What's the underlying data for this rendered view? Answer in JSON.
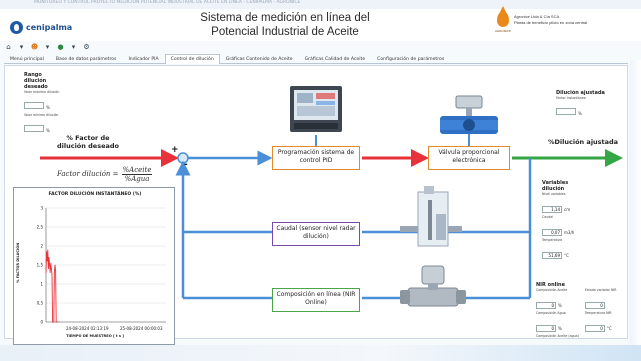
{
  "window": {
    "title": "MONITOREO Y CONTROL PROYECTO MEDICIÓN POTENCIAL INDUSTRIAL DE ACEITE EN LINEA - CENIPALMA - AGRONICE"
  },
  "header": {
    "brand": "cenipalma",
    "title_line1": "Sistema de medición en línea del",
    "title_line2": "Potencial Industrial de Aceite",
    "logo_caption": "AGRONICE",
    "company_line1": "Agronice Ltda & Cía SCA",
    "company_line2": "Planta de beneficio piloto en zona central"
  },
  "toolbar": {
    "icons": [
      "home-icon",
      "arrow-icon",
      "user-icon",
      "green-icon",
      "settings-icon"
    ]
  },
  "tabs": [
    {
      "label": "Menú principal",
      "active": false
    },
    {
      "label": "Base de datos parámetros",
      "active": false
    },
    {
      "label": "Indicador PIA",
      "active": false
    },
    {
      "label": "Control de dilución",
      "active": true
    },
    {
      "label": "Gráficas Contenido de Aceite",
      "active": false
    },
    {
      "label": "Gráficas Calidad de Aceite",
      "active": false
    },
    {
      "label": "Configuración de parámetros",
      "active": false
    }
  ],
  "rango": {
    "title": "Rango dilución deseado",
    "max_label": "Valor máximo dilución",
    "max_value": "",
    "min_label": "Valor mínimo dilución",
    "min_value": "",
    "unit": "%"
  },
  "setpoint": {
    "title": "% Factor de dilución deseado",
    "formula_lhs": "Factor dilución =",
    "formula_num": "%Aceite",
    "formula_den": "%Agua",
    "plus": "+",
    "minus": "-"
  },
  "stages": {
    "pid": "Programación sistema de control PID",
    "valve": "Válvula proporcional electrónica",
    "caudal": "Caudal (sensor nivel radar dilución)",
    "nir": "Composición en línea (NIR Online)"
  },
  "output": {
    "title": "%Dilución ajustada"
  },
  "dilucion_ajustada": {
    "title": "Dilución ajustada",
    "factor_label": "Factor instantáneo",
    "factor_value": "",
    "unit": "%"
  },
  "variables": {
    "title": "Variables dilución",
    "nivel_label": "Nivel variables",
    "nivel_value": "1,14",
    "nivel_unit": "cm",
    "caudal_label": "Caudal",
    "caudal_value": "0,07",
    "caudal_unit": "m3/h",
    "temp_label": "Temperatura",
    "temp_value": "51,69",
    "temp_unit": "°C"
  },
  "nir": {
    "title": "NIR online",
    "aceite_label": "Composición Aceite",
    "aceite_value": "0",
    "aceite_unit": "%",
    "estado_label": "Estado variador NIR",
    "estado_value": "0",
    "agua_label": "Composición Agua",
    "agua_value": "0",
    "agua_unit": "%",
    "temp_label": "Temperatura NIR",
    "temp_value": "0",
    "temp_unit": "°C",
    "agua2_label": "Composición Aceite (agua)",
    "agua2_value": "0",
    "agua2_unit": "%"
  },
  "chart_data": {
    "type": "line",
    "title": "FACTOR DILUCIÓN INSTANTÁNEO (%)",
    "xlabel": "TIEMPO DE MUESTREO [ t s ]",
    "ylabel": "% FACTOR DILUCIÓN",
    "ylim": [
      0,
      3
    ],
    "yticks": [
      0,
      0.5,
      1,
      1.5,
      2,
      2.5,
      3
    ],
    "ytick_labels": [
      "0",
      "0,5",
      "1",
      "1,5",
      "2",
      "2,5",
      "3"
    ],
    "xtick_labels": [
      "24-08-2024 02:13:19",
      "25-08-2024 00:00:03"
    ],
    "grid": true,
    "series": [
      {
        "color": "#e8323a",
        "x": [
          0,
          0.5,
          1,
          1.5,
          2,
          2.5,
          3,
          3.5,
          4,
          4.5,
          5,
          5.5,
          6,
          6.5,
          7,
          7.5,
          8,
          8.5,
          9,
          9.5,
          10
        ],
        "values": [
          1.3,
          1.85,
          1.6,
          1.9,
          1.4,
          1.7,
          1.5,
          1.3,
          1.55,
          1.4,
          1.25,
          0,
          0.0,
          0,
          1.35,
          1.5,
          1.35,
          0,
          0,
          0,
          0
        ]
      }
    ],
    "x_range": [
      0,
      100
    ]
  }
}
